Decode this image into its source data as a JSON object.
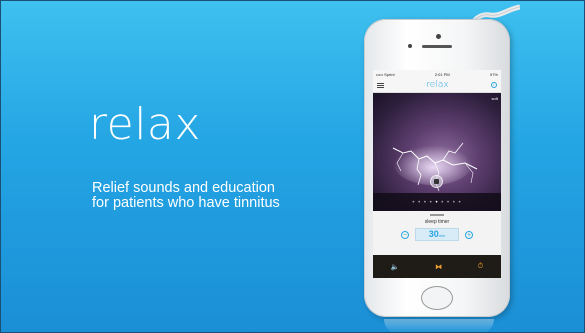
{
  "slide": {
    "title": "relax",
    "subtitle": "Relief sounds and education for patients who have tinnitus"
  },
  "phone": {
    "status": {
      "carrier": "••••• Sprint",
      "time": "2:01 PM",
      "battery": "97%"
    },
    "app": {
      "title": "relax",
      "menu_icon": "hamburger-menu-icon",
      "info_icon": "info-icon",
      "info_glyph": "i"
    },
    "scene": {
      "badge": "soft",
      "page_dots": "• • • • ",
      "active_dot": "•",
      "page_dots_after": " • • • •"
    },
    "timer": {
      "label": "sleep timer",
      "value": "30",
      "unit": "min",
      "minus": "−",
      "plus": "+"
    },
    "toolbar": {
      "volume": "🔈",
      "mix": "⧓",
      "timer": "⏱"
    }
  },
  "colors": {
    "background_top": "#3ec0f0",
    "background_bottom": "#1b8fd6",
    "accent": "#2aa5e0",
    "toolbar_accent": "#f0a030"
  }
}
